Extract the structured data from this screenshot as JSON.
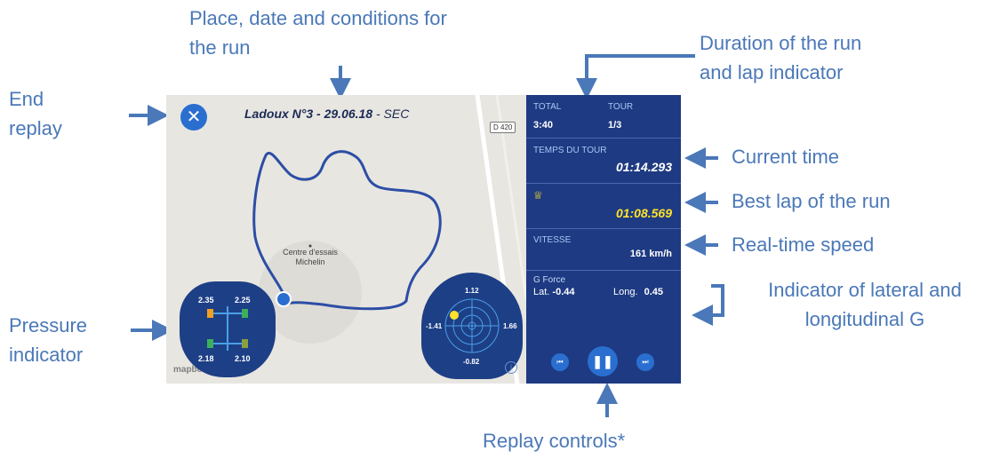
{
  "callouts": {
    "place_date": [
      "Place, date and conditions for",
      "the run"
    ],
    "duration": [
      "Duration of the run",
      "and lap indicator"
    ],
    "end_replay": [
      "End",
      "replay"
    ],
    "current_time": "Current time",
    "best_lap": "Best lap of the run",
    "speed": "Real-time speed",
    "g_indicator": [
      "Indicator of lateral and",
      "longitudinal G"
    ],
    "pressure": [
      "Pressure",
      "indicator"
    ],
    "replay_controls": "Replay controls*"
  },
  "map": {
    "title_main": "Ladoux N°3 - 29.06.18",
    "title_conditions": " - SEC",
    "road_badge": "D 420",
    "poi": [
      "Centre d'essais",
      "Michelin"
    ],
    "attribution": "mapbox"
  },
  "tires": {
    "front_left": "2.35",
    "front_right": "2.25",
    "rear_left": "2.18",
    "rear_right": "2.10"
  },
  "gforce_widget": {
    "top": "1.12",
    "left": "-1.41",
    "right": "1.66",
    "bottom": "-0.82"
  },
  "panel": {
    "total_label": "TOTAL",
    "total_value": "3:40",
    "lap_label": "TOUR",
    "lap_value": "1/3",
    "lap_time_label": "TEMPS DU TOUR",
    "lap_time_value": "01:14.293",
    "best_lap_value": "01:08.569",
    "speed_label": "VITESSE",
    "speed_value": "161 km/h",
    "gforce_label": "G Force",
    "lat_label": "Lat.",
    "lat_value": "-0.44",
    "long_label": "Long.",
    "long_value": "0.45"
  },
  "icons": {
    "close": "close-icon",
    "trophy": "trophy-icon",
    "prev": "skip-previous-icon",
    "pause": "pause-icon",
    "next": "skip-next-icon"
  },
  "colors": {
    "callout": "#4a78b8",
    "panel": "#1e3a82",
    "accent": "#2a6fd0",
    "best": "#ffe32a",
    "track": "#2c4ea5"
  }
}
